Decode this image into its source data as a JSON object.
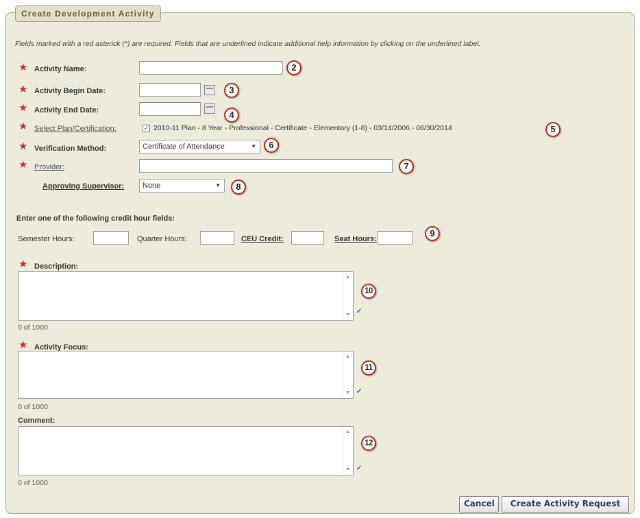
{
  "form": {
    "title": "Create Development Activity",
    "required_note": "Fields marked with a red asterick (*) are required. Fields that are underlined indicate additional help information by clicking on the underlined label.",
    "required_marker": "★"
  },
  "fields": {
    "activity_name": {
      "label": "Activity Name:",
      "value": "",
      "callout": "2"
    },
    "begin_date": {
      "label": "Activity Begin Date:",
      "value": "",
      "callout": "3"
    },
    "end_date": {
      "label": "Activity End Date:",
      "value": "",
      "callout": "4"
    },
    "plan": {
      "label": "Select Plan/Certification:",
      "option": "2010-11 Plan - 8 Year - Professional - Certificate - Elementary (1-8) - 03/14/2006 - 06/30/2014",
      "checked": true,
      "callout": "5"
    },
    "verification": {
      "label": "Verification Method:",
      "selected": "Certificate of Attendance",
      "callout": "6"
    },
    "provider": {
      "label": "Provider:",
      "value": "",
      "callout": "7"
    },
    "supervisor": {
      "label": "Approving Supervisor:",
      "selected": "None",
      "callout": "8"
    }
  },
  "credit_hours": {
    "heading": "Enter one of the following credit hour fields:",
    "semester_label": "Semester Hours:",
    "quarter_label": "Quarter Hours:",
    "ceu_label": "CEU Credit:",
    "seat_label": "Seat Hours:",
    "callout": "9"
  },
  "description": {
    "label": "Description:",
    "counter": "0 of 1000",
    "callout": "10"
  },
  "focus": {
    "label": "Activity Focus:",
    "counter": "0 of 1000",
    "callout": "11"
  },
  "comment": {
    "label": "Comment:",
    "counter": "0 of 1000",
    "callout": "12"
  },
  "buttons": {
    "cancel": "Cancel",
    "create": "Create Activity Request"
  },
  "colors": {
    "panel_bg": "#ecebdc",
    "required": "#c8322a",
    "callout_border": "#b52a1c"
  },
  "icons": [
    "calendar-icon",
    "spellcheck-icon",
    "chevron-down-icon",
    "required-asterisk-icon"
  ]
}
